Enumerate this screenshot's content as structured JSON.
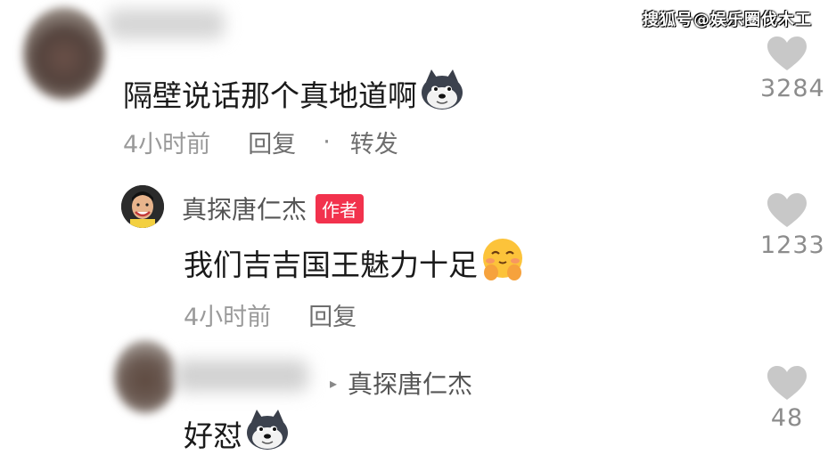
{
  "watermark": "搜狐号@娱乐圈伐木工",
  "comments": [
    {
      "text": "隔壁说话那个真地道啊",
      "emoji": "doge-emoji",
      "time": "4小时前",
      "reply_label": "回复",
      "dot": "·",
      "forward_label": "转发",
      "likes": "3284"
    },
    {
      "author": "真探唐仁杰",
      "author_badge": "作者",
      "text": "我们吉吉国王魅力十足",
      "emoji": "blush-hands-emoji",
      "time": "4小时前",
      "reply_label": "回复",
      "likes": "1233"
    },
    {
      "reply_arrow": "▸",
      "reply_to": "真探唐仁杰",
      "text": "好怼",
      "emoji": "doge-emoji",
      "likes": "48"
    }
  ],
  "colors": {
    "badge": "#f2324d",
    "heart": "#c8c8c8",
    "meta": "#9a9a9a"
  }
}
